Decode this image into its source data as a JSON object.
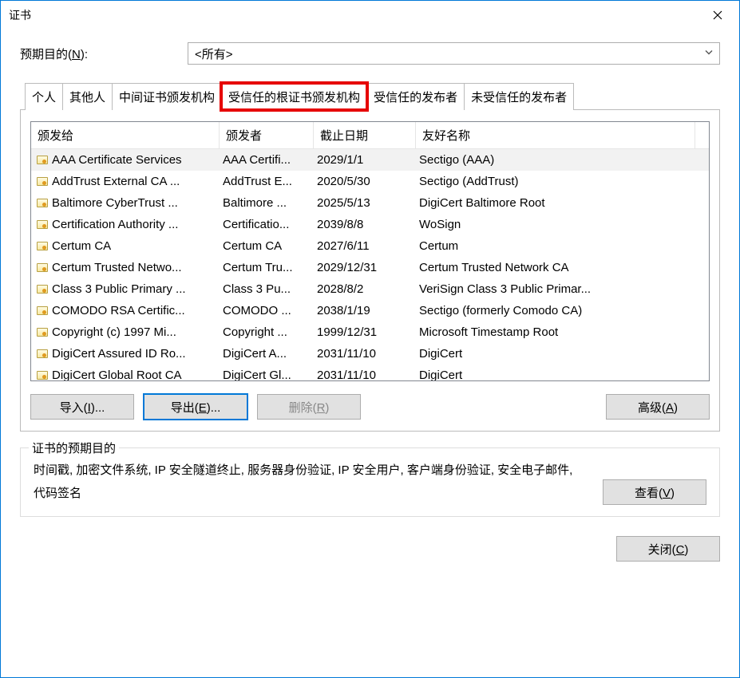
{
  "window": {
    "title": "证书"
  },
  "purpose": {
    "label_pre": "预期目的(",
    "label_u": "N",
    "label_post": "):",
    "selected": "<所有>"
  },
  "tabs": [
    {
      "label": "个人"
    },
    {
      "label": "其他人"
    },
    {
      "label": "中间证书颁发机构"
    },
    {
      "label": "受信任的根证书颁发机构",
      "highlight": true,
      "active": true
    },
    {
      "label": "受信任的发布者"
    },
    {
      "label": "未受信任的发布者"
    }
  ],
  "columns": {
    "issued_to": "颁发给",
    "issued_by": "颁发者",
    "expiry": "截止日期",
    "friendly": "友好名称"
  },
  "rows": [
    {
      "to": "AAA Certificate Services",
      "by": "AAA Certifi...",
      "exp": "2029/1/1",
      "fn": "Sectigo (AAA)",
      "selected": true
    },
    {
      "to": "AddTrust External CA ...",
      "by": "AddTrust E...",
      "exp": "2020/5/30",
      "fn": "Sectigo (AddTrust)"
    },
    {
      "to": "Baltimore CyberTrust ...",
      "by": "Baltimore ...",
      "exp": "2025/5/13",
      "fn": "DigiCert Baltimore Root"
    },
    {
      "to": "Certification Authority ...",
      "by": "Certificatio...",
      "exp": "2039/8/8",
      "fn": "WoSign"
    },
    {
      "to": "Certum CA",
      "by": "Certum CA",
      "exp": "2027/6/11",
      "fn": "Certum"
    },
    {
      "to": "Certum Trusted Netwo...",
      "by": "Certum Tru...",
      "exp": "2029/12/31",
      "fn": "Certum Trusted Network CA"
    },
    {
      "to": "Class 3 Public Primary ...",
      "by": "Class 3 Pu...",
      "exp": "2028/8/2",
      "fn": "VeriSign Class 3 Public Primar..."
    },
    {
      "to": "COMODO RSA Certific...",
      "by": "COMODO ...",
      "exp": "2038/1/19",
      "fn": "Sectigo (formerly Comodo CA)"
    },
    {
      "to": "Copyright (c) 1997 Mi...",
      "by": "Copyright ...",
      "exp": "1999/12/31",
      "fn": "Microsoft Timestamp Root"
    },
    {
      "to": "DigiCert Assured ID Ro...",
      "by": "DigiCert A...",
      "exp": "2031/11/10",
      "fn": "DigiCert"
    },
    {
      "to": "DigiCert Global Root CA",
      "by": "DigiCert Gl...",
      "exp": "2031/11/10",
      "fn": "DigiCert"
    }
  ],
  "buttons": {
    "import_pre": "导入(",
    "import_u": "I",
    "import_post": ")...",
    "export_pre": "导出(",
    "export_u": "E",
    "export_post": ")...",
    "delete_pre": "删除(",
    "delete_u": "R",
    "delete_post": ")",
    "advanced_pre": "高级(",
    "advanced_u": "A",
    "advanced_post": ")",
    "view_pre": "查看(",
    "view_u": "V",
    "view_post": ")",
    "close_pre": "关闭(",
    "close_u": "C",
    "close_post": ")"
  },
  "fieldset": {
    "legend": "证书的预期目的",
    "desc": "时间戳, 加密文件系统, IP 安全隧道终止, 服务器身份验证, IP 安全用户, 客户端身份验证, 安全电子邮件, 代码签名"
  }
}
